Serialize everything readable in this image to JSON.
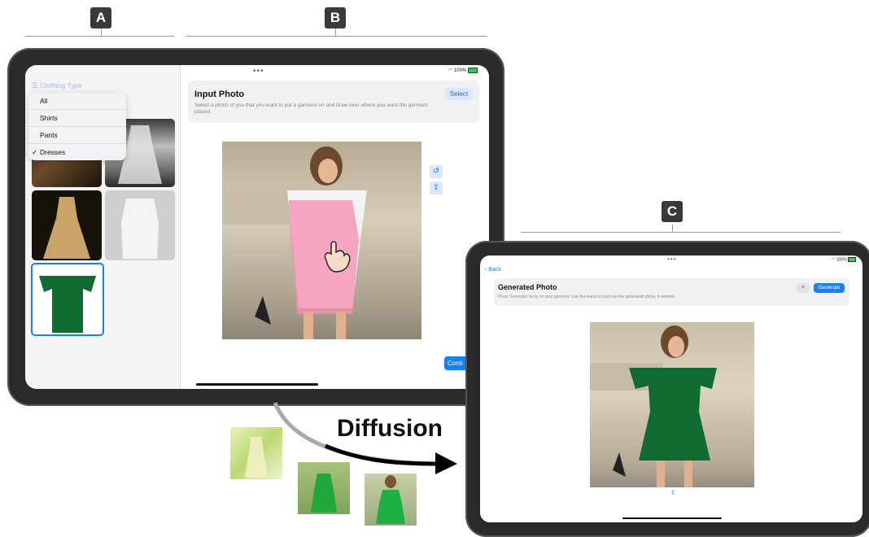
{
  "labels": {
    "a": "A",
    "b": "B",
    "c": "C"
  },
  "diffusion_label": "Diffusion",
  "colors": {
    "accent": "#1a7ff0",
    "mask": "#f48fb1",
    "dress": "#0f6b2f",
    "frame": "#2a2a2a"
  },
  "device_b": {
    "status_dots": "•••",
    "battery": "100%",
    "sidebar": {
      "title": "Clothing Type",
      "menu": [
        {
          "label": "All",
          "checked": false
        },
        {
          "label": "Shirts",
          "checked": false
        },
        {
          "label": "Pants",
          "checked": false
        },
        {
          "label": "Dresses",
          "checked": true
        }
      ],
      "check_glyph": "✓"
    },
    "card": {
      "title": "Input Photo",
      "description": "Select a photo of you that you want to put a garment on and draw over where you want the garment placed.",
      "select_label": "Select"
    },
    "continue_label": "Conti"
  },
  "device_c": {
    "status_dots": "•••",
    "battery": "100%",
    "back_label": "Back",
    "card": {
      "title": "Generated Photo",
      "description": "Press 'Generate' to try on your garment. Use the wand to touch-up the generated photo, if needed.",
      "generate_label": "Generate"
    }
  },
  "icons": [
    "list-icon",
    "undo-icon",
    "share-icon",
    "wand-icon",
    "wifi-icon",
    "battery-icon",
    "hand-pointer-icon",
    "chevron-left-icon"
  ]
}
